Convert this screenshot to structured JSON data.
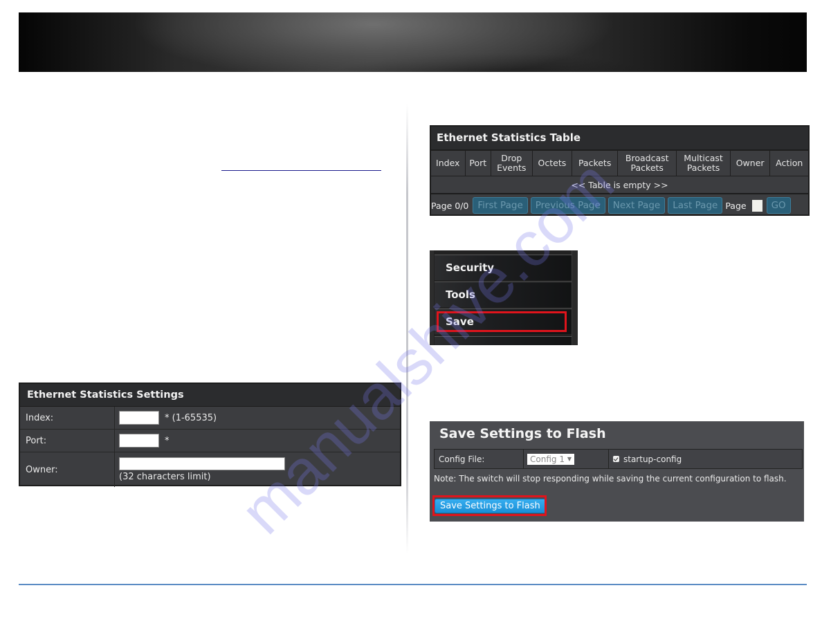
{
  "page": {
    "watermark": "manualshive.com",
    "colors": {
      "panel_bg": "#3c3d40",
      "panel_header_bg": "#2b2c2e",
      "highlight_red": "#e0141c",
      "primary_button": "#1a8fd6",
      "disabled_button": "#2a5f78",
      "footer_rule": "#5b8cc4",
      "link": "#1a1a8c"
    }
  },
  "ethernet_statistics_settings": {
    "title": "Ethernet Statistics Settings",
    "fields": [
      {
        "label": "Index:",
        "value": "",
        "hint": "* (1-65535)"
      },
      {
        "label": "Port:",
        "value": "",
        "hint": "*"
      },
      {
        "label": "Owner:",
        "value": "",
        "hint": "(32 characters limit)"
      }
    ]
  },
  "ethernet_statistics_table": {
    "title": "Ethernet Statistics Table",
    "columns": [
      [
        "Index"
      ],
      [
        "Port"
      ],
      [
        "Drop",
        "Events"
      ],
      [
        "Octets"
      ],
      [
        "Packets"
      ],
      [
        "Broadcast",
        "Packets"
      ],
      [
        "Multicast",
        "Packets"
      ],
      [
        "Owner"
      ],
      [
        "Action"
      ]
    ],
    "columns_flat": [
      "Index",
      "Port",
      "Drop Events",
      "Octets",
      "Packets",
      "Broadcast Packets",
      "Multicast Packets",
      "Owner",
      "Action"
    ],
    "rows": [],
    "empty_message": "<< Table is empty >>",
    "pager": {
      "status": "Page 0/0",
      "first": "First Page",
      "previous": "Previous Page",
      "next": "Next Page",
      "last": "Last Page",
      "page_label": "Page",
      "page_value": "",
      "go": "GO"
    }
  },
  "menu": {
    "items": [
      {
        "label": "Security",
        "highlighted": false
      },
      {
        "label": "Tools",
        "highlighted": false
      },
      {
        "label": "Save",
        "highlighted": true
      }
    ]
  },
  "save_settings_to_flash": {
    "title": "Save Settings to Flash",
    "config_file_label": "Config File:",
    "config_file_selected": "Config 1",
    "startup_config_label": "startup-config",
    "startup_config_checked": true,
    "note": "Note: The switch will stop responding while saving the current configuration to flash.",
    "button_label": "Save Settings to Flash"
  }
}
